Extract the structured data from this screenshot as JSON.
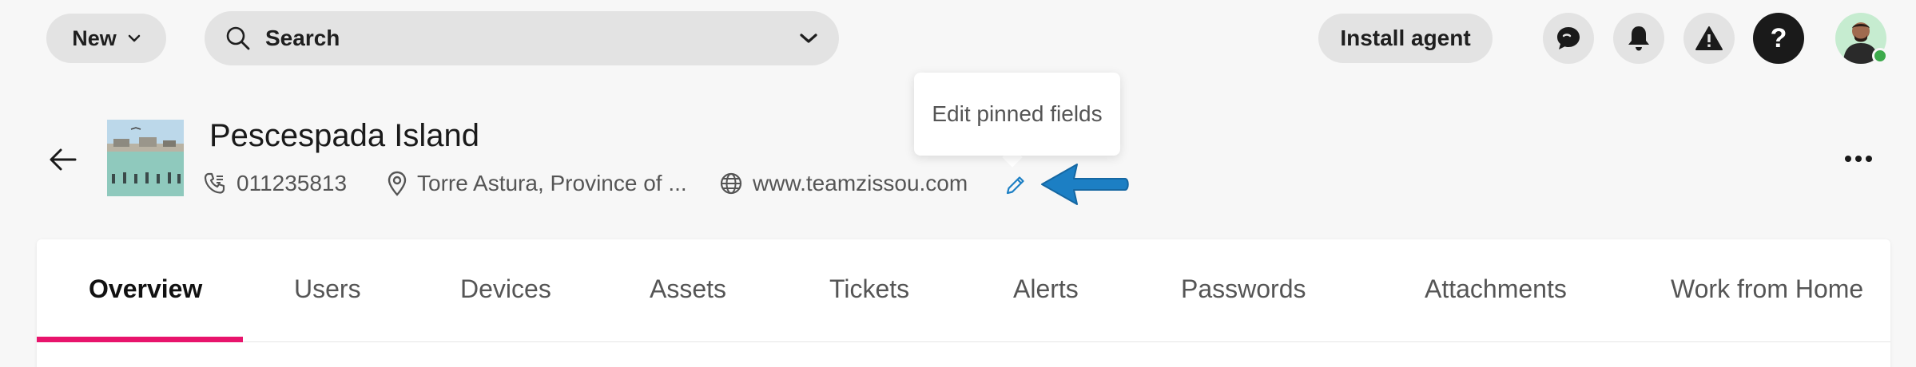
{
  "topbar": {
    "new_label": "New",
    "search_label": "Search",
    "install_label": "Install agent",
    "help_label": "?"
  },
  "tooltip": {
    "text": "Edit pinned fields"
  },
  "header": {
    "title": "Pescespada Island",
    "phone": "011235813",
    "location": "Torre Astura, Province of ...",
    "website": "www.teamzissou.com"
  },
  "tabs": [
    {
      "label": "Overview"
    },
    {
      "label": "Users"
    },
    {
      "label": "Devices"
    },
    {
      "label": "Assets"
    },
    {
      "label": "Tickets"
    },
    {
      "label": "Alerts"
    },
    {
      "label": "Passwords"
    },
    {
      "label": "Attachments"
    },
    {
      "label": "Work from Home"
    }
  ],
  "colors": {
    "active_tab_indicator": "#e8146c",
    "arrow_callout": "#1c7fc4",
    "online_status": "#3daa4c"
  }
}
